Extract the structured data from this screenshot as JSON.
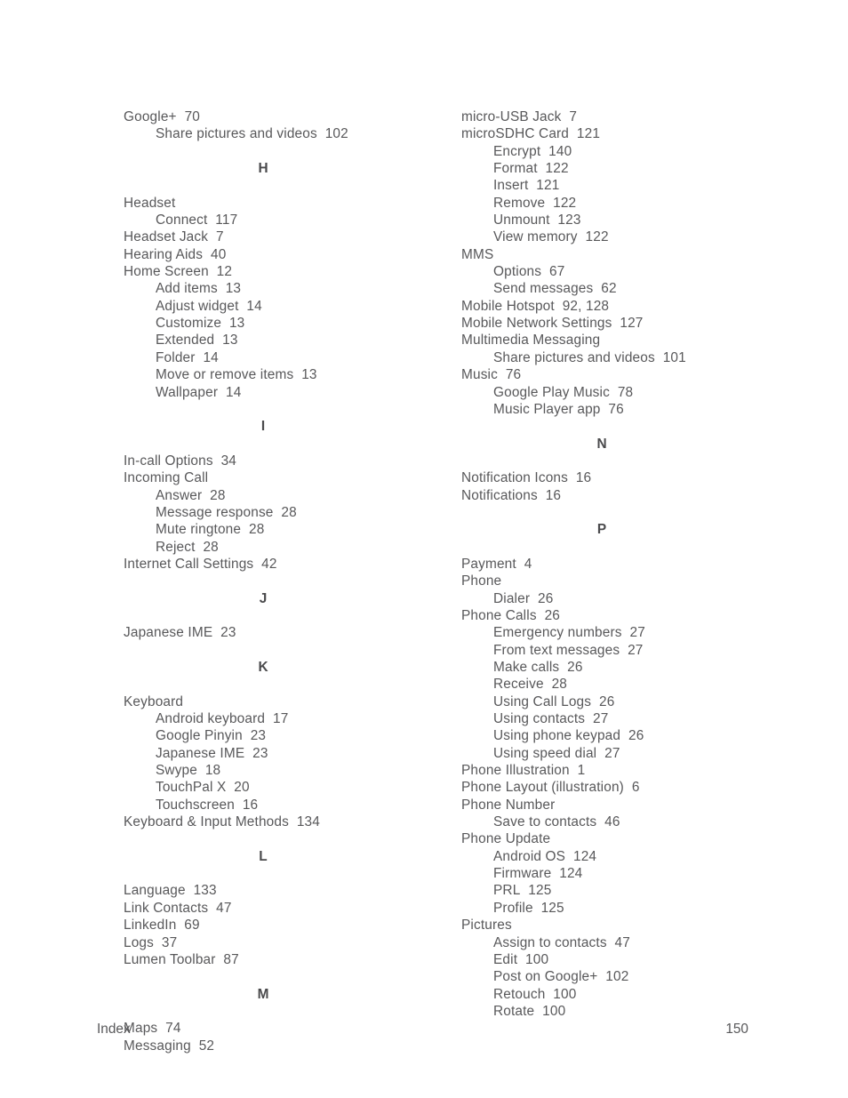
{
  "document": {
    "footer": {
      "label": "Index",
      "page_number": "150"
    }
  },
  "columns": {
    "left": [
      {
        "type": "entry",
        "level": 1,
        "term": "Google+",
        "pages": "70"
      },
      {
        "type": "entry",
        "level": 2,
        "term": "Share pictures and videos",
        "pages": "102"
      },
      {
        "type": "spacer"
      },
      {
        "type": "heading",
        "letter": "H"
      },
      {
        "type": "spacer"
      },
      {
        "type": "entry",
        "level": 1,
        "term": "Headset",
        "pages": ""
      },
      {
        "type": "entry",
        "level": 2,
        "term": "Connect",
        "pages": "117"
      },
      {
        "type": "entry",
        "level": 1,
        "term": "Headset Jack",
        "pages": "7"
      },
      {
        "type": "entry",
        "level": 1,
        "term": "Hearing Aids",
        "pages": "40"
      },
      {
        "type": "entry",
        "level": 1,
        "term": "Home Screen",
        "pages": "12"
      },
      {
        "type": "entry",
        "level": 2,
        "term": "Add items",
        "pages": "13"
      },
      {
        "type": "entry",
        "level": 2,
        "term": "Adjust widget",
        "pages": "14"
      },
      {
        "type": "entry",
        "level": 2,
        "term": "Customize",
        "pages": "13"
      },
      {
        "type": "entry",
        "level": 2,
        "term": "Extended",
        "pages": "13"
      },
      {
        "type": "entry",
        "level": 2,
        "term": "Folder",
        "pages": "14"
      },
      {
        "type": "entry",
        "level": 2,
        "term": "Move or remove items",
        "pages": "13"
      },
      {
        "type": "entry",
        "level": 2,
        "term": "Wallpaper",
        "pages": "14"
      },
      {
        "type": "spacer"
      },
      {
        "type": "heading",
        "letter": "I"
      },
      {
        "type": "spacer"
      },
      {
        "type": "entry",
        "level": 1,
        "term": "In-call Options",
        "pages": "34"
      },
      {
        "type": "entry",
        "level": 1,
        "term": "Incoming Call",
        "pages": ""
      },
      {
        "type": "entry",
        "level": 2,
        "term": "Answer",
        "pages": "28"
      },
      {
        "type": "entry",
        "level": 2,
        "term": "Message response",
        "pages": "28"
      },
      {
        "type": "entry",
        "level": 2,
        "term": "Mute ringtone",
        "pages": "28"
      },
      {
        "type": "entry",
        "level": 2,
        "term": "Reject",
        "pages": "28"
      },
      {
        "type": "entry",
        "level": 1,
        "term": "Internet Call Settings",
        "pages": "42"
      },
      {
        "type": "spacer"
      },
      {
        "type": "heading",
        "letter": "J"
      },
      {
        "type": "spacer"
      },
      {
        "type": "entry",
        "level": 1,
        "term": "Japanese IME",
        "pages": "23"
      },
      {
        "type": "spacer"
      },
      {
        "type": "heading",
        "letter": "K"
      },
      {
        "type": "spacer"
      },
      {
        "type": "entry",
        "level": 1,
        "term": "Keyboard",
        "pages": ""
      },
      {
        "type": "entry",
        "level": 2,
        "term": "Android keyboard",
        "pages": "17"
      },
      {
        "type": "entry",
        "level": 2,
        "term": "Google Pinyin",
        "pages": "23"
      },
      {
        "type": "entry",
        "level": 2,
        "term": "Japanese IME",
        "pages": "23"
      },
      {
        "type": "entry",
        "level": 2,
        "term": "Swype",
        "pages": "18"
      },
      {
        "type": "entry",
        "level": 2,
        "term": "TouchPal X",
        "pages": "20"
      },
      {
        "type": "entry",
        "level": 2,
        "term": "Touchscreen",
        "pages": "16"
      },
      {
        "type": "entry",
        "level": 1,
        "term": "Keyboard & Input Methods",
        "pages": "134"
      },
      {
        "type": "spacer"
      },
      {
        "type": "heading",
        "letter": "L"
      },
      {
        "type": "spacer"
      },
      {
        "type": "entry",
        "level": 1,
        "term": "Language",
        "pages": "133"
      },
      {
        "type": "entry",
        "level": 1,
        "term": "Link Contacts",
        "pages": "47"
      },
      {
        "type": "entry",
        "level": 1,
        "term": "LinkedIn",
        "pages": "69"
      },
      {
        "type": "entry",
        "level": 1,
        "term": "Logs",
        "pages": "37"
      },
      {
        "type": "entry",
        "level": 1,
        "term": "Lumen Toolbar",
        "pages": "87"
      },
      {
        "type": "spacer"
      },
      {
        "type": "heading",
        "letter": "M"
      },
      {
        "type": "spacer"
      },
      {
        "type": "entry",
        "level": 1,
        "term": "Maps",
        "pages": "74"
      },
      {
        "type": "entry",
        "level": 1,
        "term": "Messaging",
        "pages": "52"
      }
    ],
    "right": [
      {
        "type": "entry",
        "level": 1,
        "term": "micro-USB Jack",
        "pages": "7"
      },
      {
        "type": "entry",
        "level": 1,
        "term": "microSDHC Card",
        "pages": "121"
      },
      {
        "type": "entry",
        "level": 2,
        "term": "Encrypt",
        "pages": "140"
      },
      {
        "type": "entry",
        "level": 2,
        "term": "Format",
        "pages": "122"
      },
      {
        "type": "entry",
        "level": 2,
        "term": "Insert",
        "pages": "121"
      },
      {
        "type": "entry",
        "level": 2,
        "term": "Remove",
        "pages": "122"
      },
      {
        "type": "entry",
        "level": 2,
        "term": "Unmount",
        "pages": "123"
      },
      {
        "type": "entry",
        "level": 2,
        "term": "View memory",
        "pages": "122"
      },
      {
        "type": "entry",
        "level": 1,
        "term": "MMS",
        "pages": ""
      },
      {
        "type": "entry",
        "level": 2,
        "term": "Options",
        "pages": "67"
      },
      {
        "type": "entry",
        "level": 2,
        "term": "Send messages",
        "pages": "62"
      },
      {
        "type": "entry",
        "level": 1,
        "term": "Mobile Hotspot",
        "pages": "92, 128"
      },
      {
        "type": "entry",
        "level": 1,
        "term": "Mobile Network Settings",
        "pages": "127"
      },
      {
        "type": "entry",
        "level": 1,
        "term": "Multimedia Messaging",
        "pages": ""
      },
      {
        "type": "entry",
        "level": 2,
        "term": "Share pictures and videos",
        "pages": "101"
      },
      {
        "type": "entry",
        "level": 1,
        "term": "Music",
        "pages": "76"
      },
      {
        "type": "entry",
        "level": 2,
        "term": "Google Play Music",
        "pages": "78"
      },
      {
        "type": "entry",
        "level": 2,
        "term": "Music Player app",
        "pages": "76"
      },
      {
        "type": "spacer"
      },
      {
        "type": "heading",
        "letter": "N"
      },
      {
        "type": "spacer"
      },
      {
        "type": "entry",
        "level": 1,
        "term": "Notification Icons",
        "pages": "16"
      },
      {
        "type": "entry",
        "level": 1,
        "term": "Notifications",
        "pages": "16"
      },
      {
        "type": "spacer"
      },
      {
        "type": "heading",
        "letter": "P"
      },
      {
        "type": "spacer"
      },
      {
        "type": "entry",
        "level": 1,
        "term": "Payment",
        "pages": "4"
      },
      {
        "type": "entry",
        "level": 1,
        "term": "Phone",
        "pages": ""
      },
      {
        "type": "entry",
        "level": 2,
        "term": "Dialer",
        "pages": "26"
      },
      {
        "type": "entry",
        "level": 1,
        "term": "Phone Calls",
        "pages": "26"
      },
      {
        "type": "entry",
        "level": 2,
        "term": "Emergency numbers",
        "pages": "27"
      },
      {
        "type": "entry",
        "level": 2,
        "term": "From text messages",
        "pages": "27"
      },
      {
        "type": "entry",
        "level": 2,
        "term": "Make calls",
        "pages": "26"
      },
      {
        "type": "entry",
        "level": 2,
        "term": "Receive",
        "pages": "28"
      },
      {
        "type": "entry",
        "level": 2,
        "term": "Using Call Logs",
        "pages": "26"
      },
      {
        "type": "entry",
        "level": 2,
        "term": "Using contacts",
        "pages": "27"
      },
      {
        "type": "entry",
        "level": 2,
        "term": "Using phone keypad",
        "pages": "26"
      },
      {
        "type": "entry",
        "level": 2,
        "term": "Using speed dial",
        "pages": "27"
      },
      {
        "type": "entry",
        "level": 1,
        "term": "Phone Illustration",
        "pages": "1"
      },
      {
        "type": "entry",
        "level": 1,
        "term": "Phone Layout (illustration)",
        "pages": "6"
      },
      {
        "type": "entry",
        "level": 1,
        "term": "Phone Number",
        "pages": ""
      },
      {
        "type": "entry",
        "level": 2,
        "term": "Save to contacts",
        "pages": "46"
      },
      {
        "type": "entry",
        "level": 1,
        "term": "Phone Update",
        "pages": ""
      },
      {
        "type": "entry",
        "level": 2,
        "term": "Android OS",
        "pages": "124"
      },
      {
        "type": "entry",
        "level": 2,
        "term": "Firmware",
        "pages": "124"
      },
      {
        "type": "entry",
        "level": 2,
        "term": "PRL",
        "pages": "125"
      },
      {
        "type": "entry",
        "level": 2,
        "term": "Profile",
        "pages": "125"
      },
      {
        "type": "entry",
        "level": 1,
        "term": "Pictures",
        "pages": ""
      },
      {
        "type": "entry",
        "level": 2,
        "term": "Assign to contacts",
        "pages": "47"
      },
      {
        "type": "entry",
        "level": 2,
        "term": "Edit",
        "pages": "100"
      },
      {
        "type": "entry",
        "level": 2,
        "term": "Post on Google+",
        "pages": "102"
      },
      {
        "type": "entry",
        "level": 2,
        "term": "Retouch",
        "pages": "100"
      },
      {
        "type": "entry",
        "level": 2,
        "term": "Rotate",
        "pages": "100"
      }
    ]
  }
}
